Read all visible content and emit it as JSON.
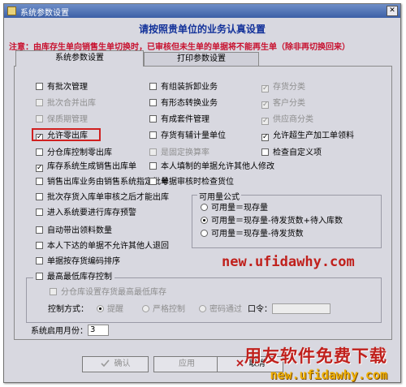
{
  "window": {
    "title": "系统参数设置"
  },
  "heading": "请按照贵单位的业务认真设置",
  "notice": "注意：由库存生单向销售生单切换时，已审核但未生单的单据将不能再生单（除非再切换回来）",
  "tabs": [
    {
      "label": "系统参数设置",
      "active": true
    },
    {
      "label": "打印参数设置",
      "active": false
    }
  ],
  "col1": [
    {
      "label": "有批次管理",
      "checked": false,
      "enabled": true
    },
    {
      "label": "批次合并出库",
      "checked": false,
      "enabled": false
    },
    {
      "label": "保质期管理",
      "checked": false,
      "enabled": false
    },
    {
      "label": "允许零出库",
      "checked": true,
      "enabled": true
    },
    {
      "label": "分仓库控制零出库",
      "checked": false,
      "enabled": true
    },
    {
      "label": "库存系统生成销售出库单",
      "checked": true,
      "enabled": true
    },
    {
      "label": "销售出库业务由销售系统指定批号",
      "checked": false,
      "enabled": true
    },
    {
      "label": "批次存货入库单审核之后才能出库",
      "checked": false,
      "enabled": true
    },
    {
      "label": "进入系统要进行库存预警",
      "checked": false,
      "enabled": true
    },
    {
      "label": "自动带出领料数量",
      "checked": false,
      "enabled": true
    },
    {
      "label": "本人下达的单据不允许其他人退回",
      "checked": false,
      "enabled": true
    },
    {
      "label": "单据按存货编码排序",
      "checked": false,
      "enabled": true
    }
  ],
  "col2": [
    {
      "label": "有组装拆卸业务",
      "checked": false,
      "enabled": true
    },
    {
      "label": "有形态转换业务",
      "checked": false,
      "enabled": true
    },
    {
      "label": "有成套件管理",
      "checked": false,
      "enabled": true
    },
    {
      "label": "存货有辅计量单位",
      "checked": false,
      "enabled": true
    },
    {
      "label": "是固定换算率",
      "checked": false,
      "enabled": false
    },
    {
      "label": "本人填制的单据允许其他人修改",
      "checked": false,
      "enabled": true
    },
    {
      "label": "单据审核时检查货位",
      "checked": false,
      "enabled": true
    }
  ],
  "col3": [
    {
      "label": "存货分类",
      "checked": true,
      "enabled": false
    },
    {
      "label": "客户分类",
      "checked": true,
      "enabled": false
    },
    {
      "label": "供应商分类",
      "checked": true,
      "enabled": false
    },
    {
      "label": "允许超生产加工单领料",
      "checked": true,
      "enabled": true
    },
    {
      "label": "检查自定义项",
      "checked": false,
      "enabled": true
    }
  ],
  "available_qty": {
    "title": "可用量公式",
    "options": [
      {
        "label": "可用量＝现存量",
        "selected": false
      },
      {
        "label": "可用量＝现存量-待发货数+待入库数",
        "selected": true
      },
      {
        "label": "可用量＝现存量-待发货数",
        "selected": false
      }
    ]
  },
  "watermark_url": "new.ufidawhy.com",
  "max_stock": {
    "label": "最高最低库存控制",
    "checked": false,
    "sub_label": "分仓库设置存货最高最低库存",
    "sub_checked": false,
    "control_label": "控制方式：",
    "modes": [
      "提醒",
      "严格控制",
      "密码通过"
    ],
    "password_label": "口令：",
    "password_value": ""
  },
  "enable_month": {
    "label": "系统启用月份：",
    "value": "3"
  },
  "buttons": {
    "confirm": "确认",
    "apply": "应用",
    "cancel": "取消"
  },
  "brand_watermark": {
    "line1": "用友软件免费下载",
    "line2": "new.ufidawhy.com"
  },
  "colors": {
    "title_blue": "#13329a",
    "notice_red": "#c8102e",
    "highlight": "#d02020"
  }
}
